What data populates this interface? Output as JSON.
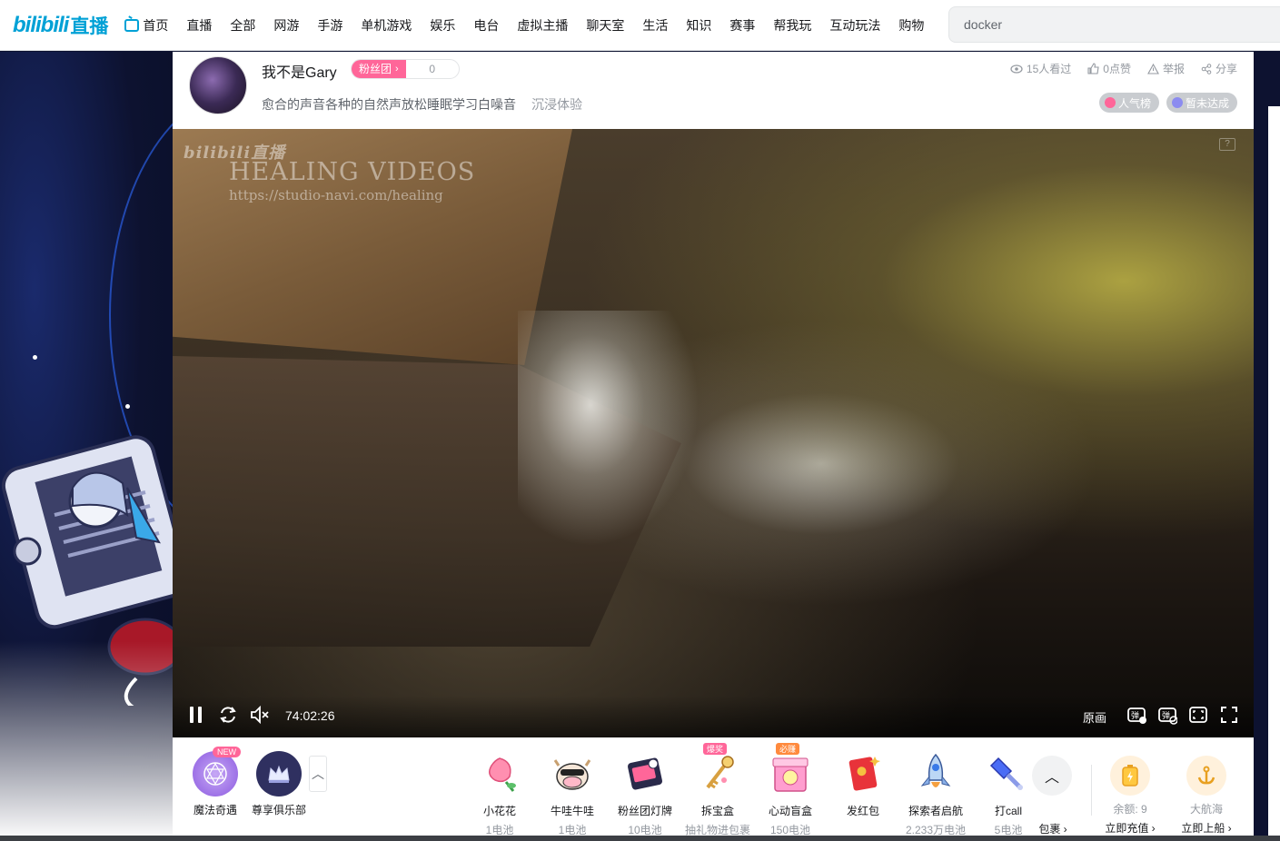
{
  "logo": {
    "bili": "bilibili",
    "live": "直播"
  },
  "nav": {
    "items": [
      "首页",
      "直播",
      "全部",
      "网游",
      "手游",
      "单机游戏",
      "娱乐",
      "电台",
      "虚拟主播",
      "聊天室",
      "生活",
      "知识",
      "赛事",
      "帮我玩",
      "互动玩法",
      "购物"
    ]
  },
  "search": {
    "value": "docker"
  },
  "room": {
    "host_name": "我不是Gary",
    "fan_club_label": "粉丝团",
    "fan_club_count": "0",
    "title": "愈合的声音各种的自然声放松睡眠学习白噪音",
    "area": "沉浸体验",
    "stats": {
      "viewers": "15人看过",
      "likes": "0点赞",
      "report": "举报",
      "share": "分享"
    },
    "badges": [
      {
        "label": "人气榜",
        "color": "#ff6699"
      },
      {
        "label": "暂未达成",
        "color": "#8c8cf0"
      }
    ]
  },
  "player": {
    "watermark_brand": "bilibili直播",
    "watermark_title": "HEALING VIDEOS",
    "watermark_url": "https://studio-navi.com/healing",
    "time": "74:02:26",
    "quality": "原画",
    "help": "?"
  },
  "gift_bar": {
    "left": [
      {
        "label": "魔法奇遇",
        "tag": "NEW",
        "icon": "magic-circle-icon"
      },
      {
        "label": "尊享俱乐部",
        "icon": "crown-icon"
      }
    ],
    "gifts": [
      {
        "name": "小花花",
        "price": "1电池",
        "color": "#ff8fb0",
        "icon": "flower-icon"
      },
      {
        "name": "牛哇牛哇",
        "price": "1电池",
        "color": "#f5e6d8",
        "icon": "cow-icon"
      },
      {
        "name": "粉丝团灯牌",
        "price": "10电池",
        "color": "#2a2a4a",
        "icon": "fan-lightboard-icon"
      },
      {
        "name": "拆宝盒",
        "price": "抽礼物进包裹",
        "tag": "爆奖",
        "tag_color": "#ff6699",
        "color": "#e8d6f5",
        "icon": "treasure-key-icon"
      },
      {
        "name": "心动盲盒",
        "price": "150电池",
        "tag": "必赚",
        "tag_color": "#ff8a3d",
        "color": "#ff9ecf",
        "icon": "blind-box-icon"
      },
      {
        "name": "发红包",
        "price": "",
        "color": "#e8333a",
        "icon": "red-envelope-icon"
      },
      {
        "name": "探索者启航",
        "price": "2.233万电池",
        "color": "#bcd7f5",
        "icon": "rocket-icon"
      },
      {
        "name": "打call",
        "price": "5电池",
        "color": "#4a6cf5",
        "icon": "glowstick-icon"
      }
    ],
    "package_label": "包裹",
    "balance": "余额: 9",
    "recharge": "立即充值",
    "captain": "大航海",
    "board": "立即上船"
  },
  "colors": {
    "accent": "#00a1d6",
    "pink": "#ff6699"
  }
}
